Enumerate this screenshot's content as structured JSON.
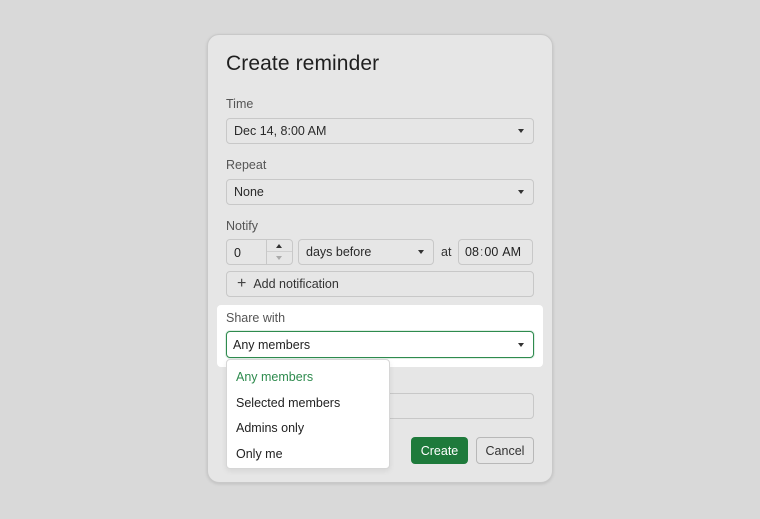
{
  "dialog": {
    "title": "Create reminder",
    "time_label": "Time",
    "time_value": "Dec 14, 8:00 AM",
    "repeat_label": "Repeat",
    "repeat_value": "None",
    "notify_label": "Notify",
    "notify_amount": "0",
    "notify_unit": "days before",
    "at_label": "at",
    "notify_hour": "08",
    "notify_minute": "00",
    "notify_ampm": "AM",
    "add_notification_label": "Add notification",
    "share_label": "Share with",
    "share_value": "Any members",
    "share_options": [
      "Any members",
      "Selected members",
      "Admins only",
      "Only me"
    ],
    "create_label": "Create",
    "cancel_label": "Cancel"
  },
  "colors": {
    "accent": "#1e7a3b",
    "selected_option": "#2e8b4e",
    "backdrop": "#d9d9d9"
  }
}
